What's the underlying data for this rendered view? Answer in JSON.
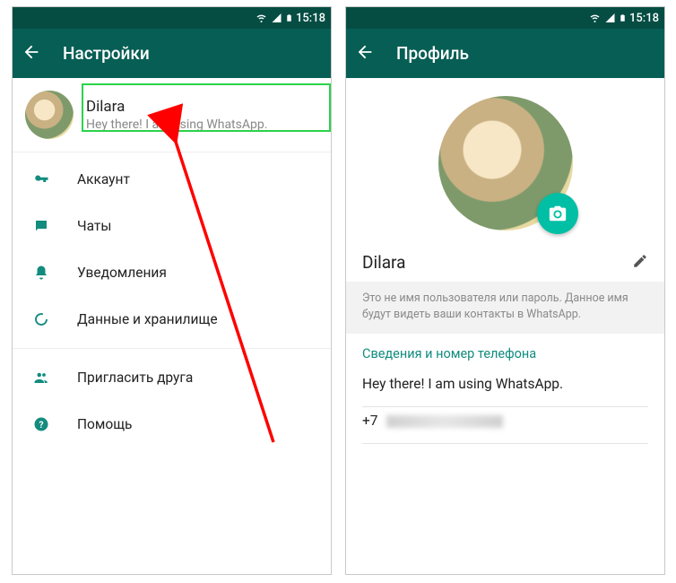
{
  "statusbar": {
    "time": "15:18"
  },
  "left": {
    "appbar_title": "Настройки",
    "profile": {
      "name": "Dilara",
      "status": "Hey there! I am using WhatsApp."
    },
    "menu": [
      {
        "key": "account",
        "label": "Аккаунт"
      },
      {
        "key": "chats",
        "label": "Чаты"
      },
      {
        "key": "notifications",
        "label": "Уведомления"
      },
      {
        "key": "data",
        "label": "Данные и хранилище"
      },
      {
        "key": "invite",
        "label": "Пригласить друга"
      },
      {
        "key": "help",
        "label": "Помощь"
      }
    ]
  },
  "right": {
    "appbar_title": "Профиль",
    "name": "Dilara",
    "note": "Это не имя пользователя или пароль. Данное имя будут видеть ваши контакты в WhatsApp.",
    "info_heading": "Сведения и номер телефона",
    "about": "Hey there! I am using WhatsApp.",
    "phone_prefix": "+7"
  }
}
